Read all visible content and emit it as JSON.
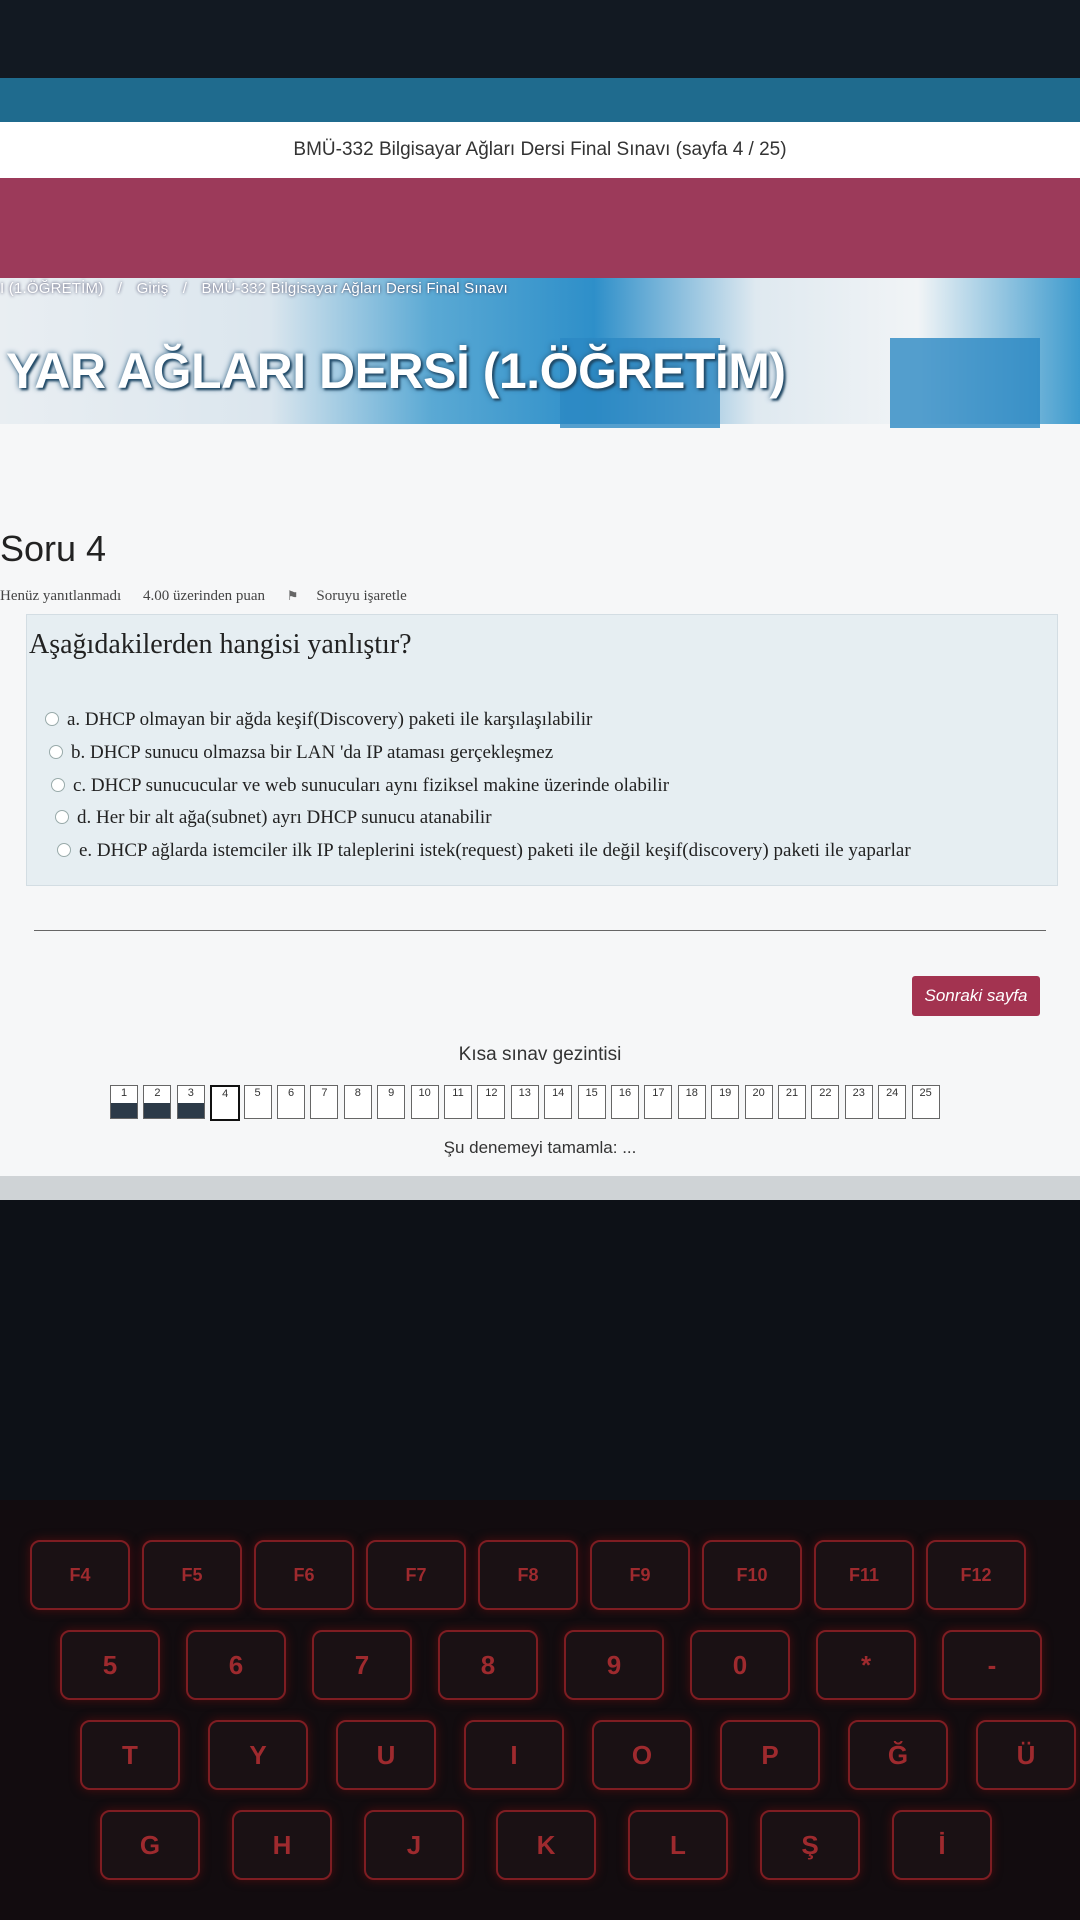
{
  "window": {
    "title": "BMÜ-332 Bilgisayar Ağları Dersi Final Sınavı (sayfa 4 / 25)"
  },
  "breadcrumb": [
    "I (1.ÖĞRETİM)",
    "/",
    "Giriş",
    "/",
    "BMÜ-332 Bilgisayar Ağları Dersi Final Sınavı"
  ],
  "course_title": "YAR AĞLARI DERSİ (1.ÖĞRETİM)",
  "question": {
    "header": "Soru 4",
    "status": "Henüz yanıtlanmadı",
    "points": "4.00 üzerinden puan",
    "flag_label": "Soruyu işaretle",
    "text": "Aşağıdakilerden hangisi yanlıştır?",
    "answers": [
      "a. DHCP olmayan bir ağda keşif(Discovery) paketi ile karşılaşılabilir",
      "b. DHCP sunucu olmazsa bir LAN 'da IP ataması gerçekleşmez",
      "c. DHCP sunucucular ve web sunucuları aynı fiziksel makine üzerinde olabilir",
      "d. Her bir alt ağa(subnet) ayrı DHCP sunucu atanabilir",
      "e. DHCP ağlarda istemciler ilk IP taleplerini istek(request) paketi ile değil keşif(discovery) paketi ile yaparlar"
    ]
  },
  "next_button": "Sonraki sayfa",
  "quiz_nav": {
    "title": "Kısa sınav gezintisi",
    "pages": [
      "1",
      "2",
      "3",
      "4",
      "5",
      "6",
      "7",
      "8",
      "9",
      "10",
      "11",
      "12",
      "13",
      "14",
      "15",
      "16",
      "17",
      "18",
      "19",
      "20",
      "21",
      "22",
      "23",
      "24",
      "25"
    ],
    "answered": [
      1,
      2,
      3
    ],
    "current": 4
  },
  "finish_link": "Şu denemeyi tamamla: ...",
  "keyboard": {
    "row1": [
      "F4",
      "F5",
      "F6",
      "F7",
      "F8",
      "F9",
      "F10",
      "F11",
      "F12"
    ],
    "row2": [
      "5",
      "6",
      "7",
      "8",
      "9",
      "0",
      "*",
      "-"
    ],
    "row3": [
      "T",
      "Y",
      "U",
      "I",
      "O",
      "P",
      "Ğ",
      "Ü"
    ],
    "row4": [
      "G",
      "H",
      "J",
      "K",
      "L",
      "Ş",
      "İ"
    ]
  }
}
